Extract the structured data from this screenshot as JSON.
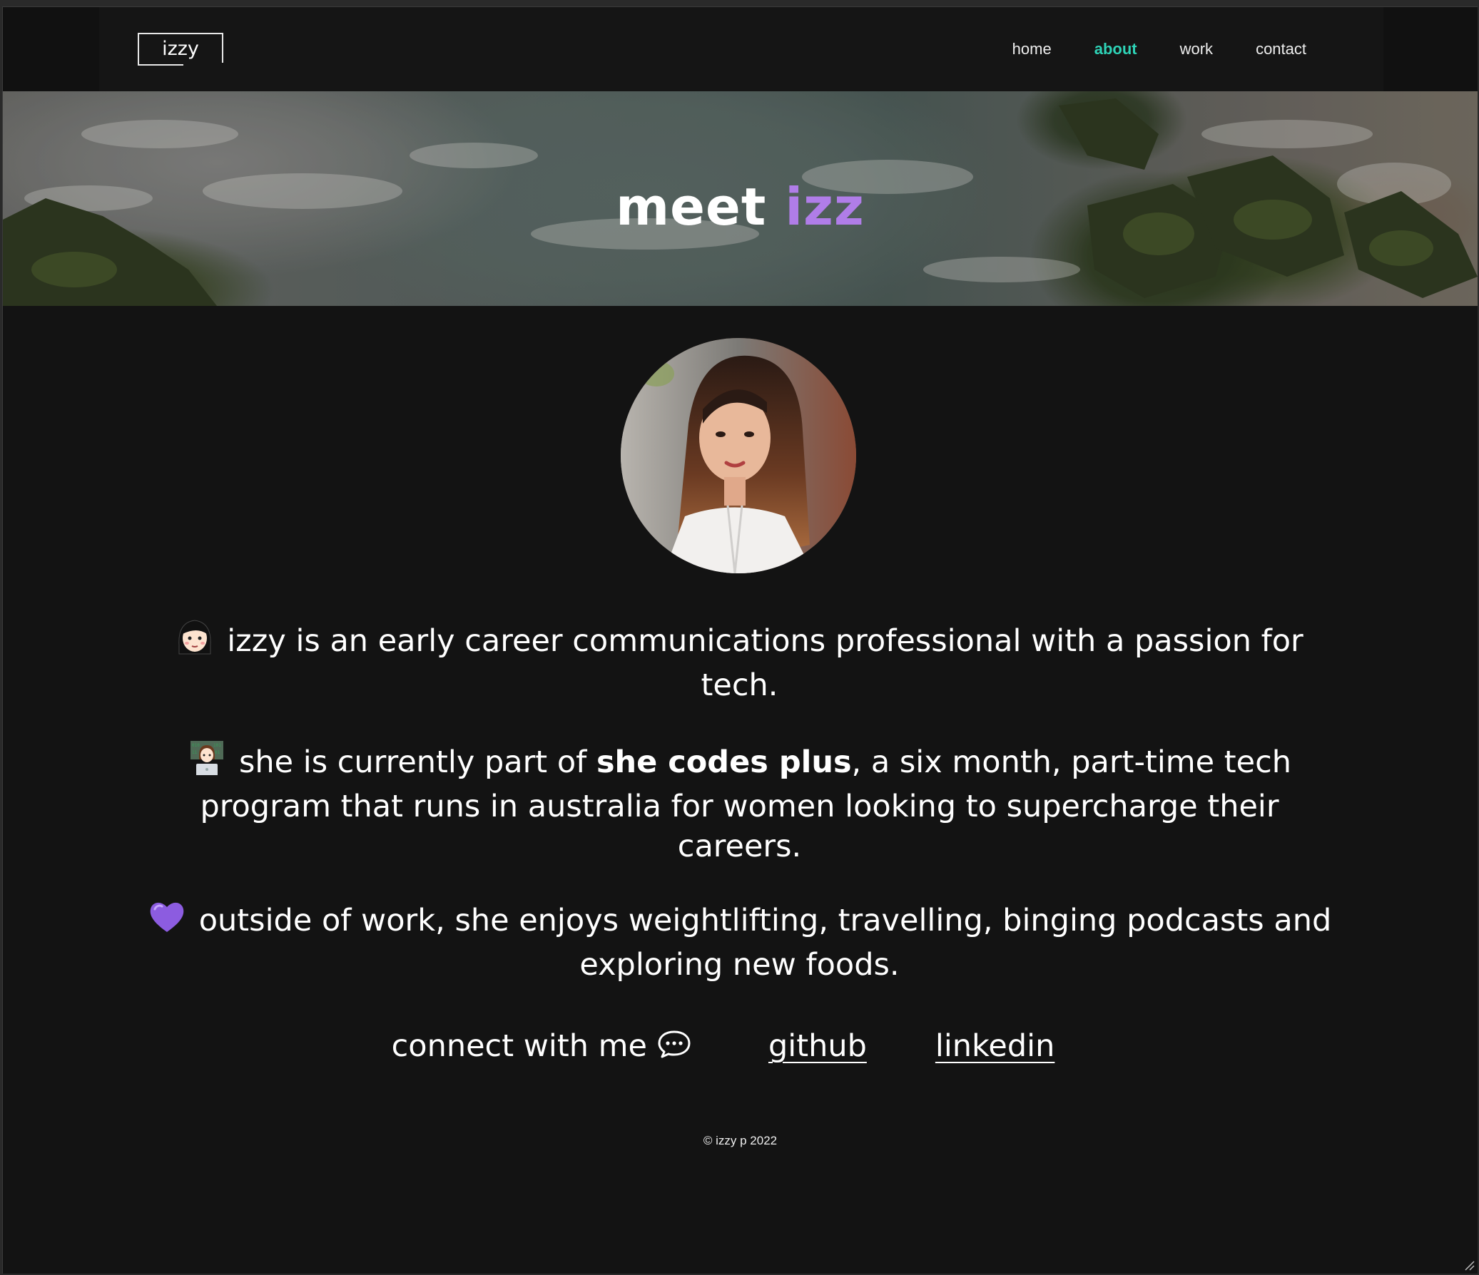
{
  "navbar": {
    "logo": "izzy",
    "links": [
      {
        "label": "home",
        "active": false
      },
      {
        "label": "about",
        "active": true
      },
      {
        "label": "work",
        "active": false
      },
      {
        "label": "contact",
        "active": false
      }
    ]
  },
  "hero": {
    "title_prefix": "meet ",
    "title_accent": "izz"
  },
  "about": {
    "paragraph_1": "izzy is an early career communications professional with a passion for tech.",
    "paragraph_2_before": "she is currently part of ",
    "paragraph_2_bold": "she codes plus",
    "paragraph_2_after": ", a six month, part-time tech program that runs in australia for women looking to supercharge their careers.",
    "paragraph_3": "outside of work, she enjoys weightlifting, travelling, binging podcasts and exploring new foods."
  },
  "connect": {
    "label": "connect with me",
    "github": "github",
    "linkedin": "linkedin"
  },
  "footer": {
    "text": "© izzy p 2022"
  },
  "colors": {
    "accent_teal": "#2ed3b7",
    "accent_purple": "#b07de8",
    "background": "#131313"
  },
  "icons": {
    "paragraph_1": "woman-face-icon",
    "paragraph_2": "woman-technologist-icon",
    "paragraph_3": "purple-heart-icon",
    "connect": "speech-bubble-icon"
  }
}
